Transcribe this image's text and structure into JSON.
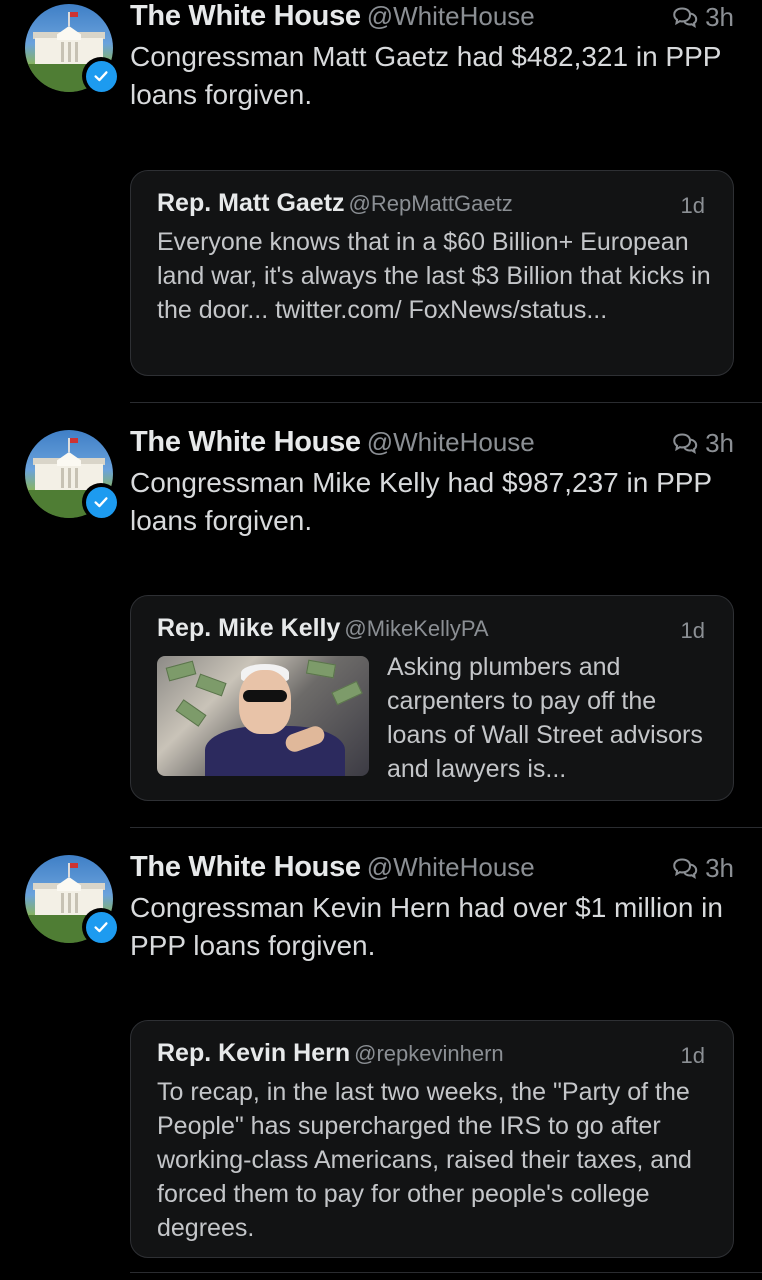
{
  "tweets": [
    {
      "author": "The White House",
      "handle": "@WhiteHouse",
      "time": "3h",
      "text": "Congressman Matt Gaetz had $482,321 in PPP loans forgiven.",
      "quote": {
        "author": "Rep. Matt Gaetz",
        "handle": "@RepMattGaetz",
        "time": "1d",
        "text": "Everyone knows that in a $60 Billion+ European land war, it's always the last $3 Billion that kicks in the door... twitter.com/ FoxNews/status..."
      }
    },
    {
      "author": "The White House",
      "handle": "@WhiteHouse",
      "time": "3h",
      "text": "Congressman Mike Kelly had $987,237 in PPP loans forgiven.",
      "quote": {
        "author": "Rep. Mike Kelly",
        "handle": "@MikeKellyPA",
        "time": "1d",
        "text": "Asking plumbers and carpenters to pay off the loans of Wall Street advisors and lawyers is..."
      }
    },
    {
      "author": "The White House",
      "handle": "@WhiteHouse",
      "time": "3h",
      "text": "Congressman Kevin Hern had over $1 million in PPP loans forgiven.",
      "quote": {
        "author": "Rep. Kevin Hern",
        "handle": "@repkevinhern",
        "time": "1d",
        "text": "To recap, in the last two weeks, the \"Party of the People\" has supercharged the IRS to go after working-class Americans, raised their taxes, and forced them to pay for other people's college degrees."
      }
    }
  ],
  "icons": {
    "verified": "verified-badge-icon",
    "thread": "conversation-icon",
    "avatar": "white-house-avatar"
  },
  "colors": {
    "background": "#000000",
    "verified": "#1d9bf0",
    "secondary_text": "#8b8f94"
  }
}
